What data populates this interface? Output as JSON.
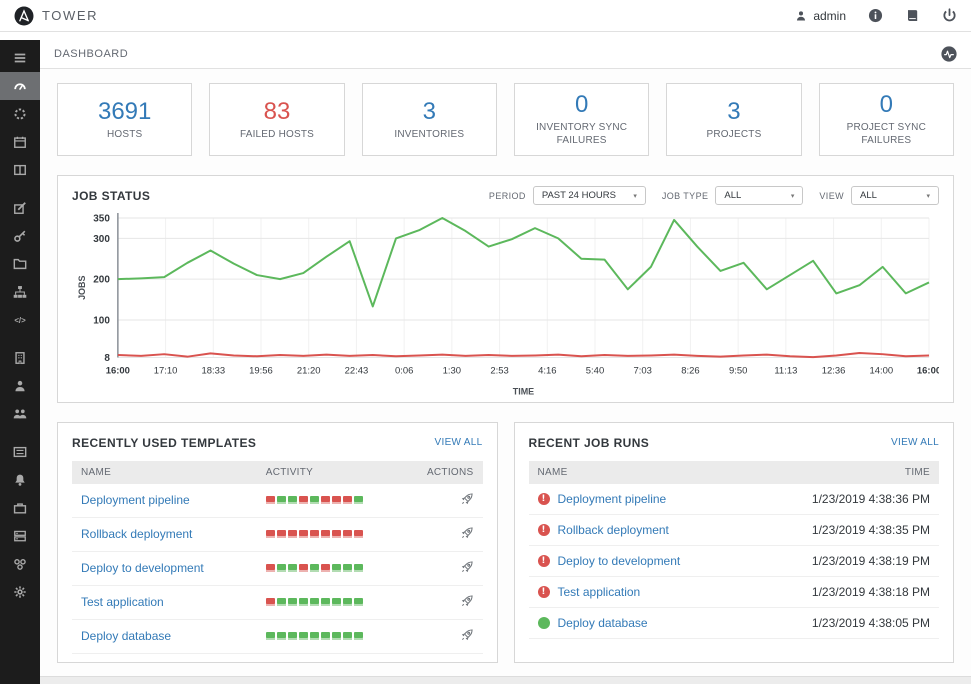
{
  "topbar": {
    "brand": "TOWER",
    "user": "admin",
    "icons": [
      "ansible-logo-icon",
      "user-icon",
      "info-icon",
      "docs-icon",
      "power-icon"
    ]
  },
  "breadcrumb": {
    "title": "DASHBOARD",
    "icons": [
      "activity-stream-icon"
    ]
  },
  "sidebar": {
    "items": [
      {
        "icon": "menu"
      },
      {
        "icon": "dashboard",
        "active": true
      },
      {
        "icon": "jobs"
      },
      {
        "icon": "schedules"
      },
      {
        "icon": "portal"
      },
      {
        "divider": true
      },
      {
        "icon": "projects"
      },
      {
        "icon": "credentials"
      },
      {
        "icon": "inventories"
      },
      {
        "icon": "templates"
      },
      {
        "icon": "inventory-scripts"
      },
      {
        "divider": true
      },
      {
        "icon": "organizations"
      },
      {
        "icon": "users"
      },
      {
        "icon": "teams"
      },
      {
        "divider": true
      },
      {
        "icon": "credential-types"
      },
      {
        "icon": "notifications"
      },
      {
        "icon": "management-jobs"
      },
      {
        "icon": "instance-groups"
      },
      {
        "icon": "applications"
      },
      {
        "icon": "settings"
      }
    ]
  },
  "stats": [
    {
      "value": "3691",
      "label": "HOSTS",
      "color": "#337ab7"
    },
    {
      "value": "83",
      "label": "FAILED HOSTS",
      "color": "#d9534f"
    },
    {
      "value": "3",
      "label": "INVENTORIES",
      "color": "#337ab7"
    },
    {
      "value": "0",
      "label": "INVENTORY SYNC FAILURES",
      "color": "#337ab7"
    },
    {
      "value": "3",
      "label": "PROJECTS",
      "color": "#337ab7"
    },
    {
      "value": "0",
      "label": "PROJECT SYNC FAILURES",
      "color": "#337ab7"
    }
  ],
  "job_status": {
    "title": "JOB STATUS",
    "filters": [
      {
        "label": "PERIOD",
        "value": "PAST 24 HOURS"
      },
      {
        "label": "JOB TYPE",
        "value": "ALL"
      },
      {
        "label": "VIEW",
        "value": "ALL"
      }
    ]
  },
  "chart_data": {
    "type": "line",
    "title": "JOB STATUS",
    "xlabel": "TIME",
    "ylabel": "JOBS",
    "ylim": [
      8,
      350
    ],
    "yticks": [
      350,
      300,
      200,
      100,
      8
    ],
    "grid": true,
    "legend": false,
    "xticklabels": [
      "16:00",
      "17:10",
      "18:33",
      "19:56",
      "21:20",
      "22:43",
      "0:06",
      "1:30",
      "2:53",
      "4:16",
      "5:40",
      "7:03",
      "8:26",
      "9:50",
      "11:13",
      "12:36",
      "14:00",
      "16:00"
    ],
    "series": [
      {
        "name": "successful",
        "color": "#5cb85c",
        "values": [
          200,
          202,
          205,
          240,
          270,
          238,
          210,
          200,
          215,
          255,
          293,
          133,
          300,
          320,
          350,
          318,
          280,
          298,
          325,
          300,
          250,
          248,
          175,
          230,
          345,
          280,
          220,
          240,
          175,
          210,
          245,
          165,
          185,
          230,
          165,
          192
        ]
      },
      {
        "name": "failed",
        "color": "#d9534f",
        "values": [
          14,
          12,
          16,
          10,
          18,
          13,
          11,
          14,
          12,
          15,
          12,
          14,
          11,
          13,
          15,
          12,
          14,
          12,
          13,
          15,
          11,
          14,
          12,
          13,
          15,
          12,
          10,
          13,
          15,
          11,
          9,
          13,
          19,
          16,
          11,
          13
        ]
      }
    ]
  },
  "templates_panel": {
    "title": "RECENTLY USED TEMPLATES",
    "view_all": "VIEW ALL",
    "columns": [
      "NAME",
      "ACTIVITY",
      "ACTIONS"
    ],
    "rows": [
      {
        "name": "Deployment pipeline",
        "activity": [
          "f",
          "s",
          "s",
          "f",
          "s",
          "f",
          "f",
          "f",
          "s"
        ]
      },
      {
        "name": "Rollback deployment",
        "activity": [
          "f",
          "f",
          "f",
          "f",
          "f",
          "f",
          "f",
          "f",
          "f"
        ]
      },
      {
        "name": "Deploy to development",
        "activity": [
          "f",
          "s",
          "s",
          "f",
          "s",
          "f",
          "s",
          "s",
          "s"
        ]
      },
      {
        "name": "Test application",
        "activity": [
          "f",
          "s",
          "s",
          "s",
          "s",
          "s",
          "s",
          "s",
          "s"
        ]
      },
      {
        "name": "Deploy database",
        "activity": [
          "s",
          "s",
          "s",
          "s",
          "s",
          "s",
          "s",
          "s",
          "s"
        ]
      }
    ]
  },
  "jobs_panel": {
    "title": "RECENT JOB RUNS",
    "view_all": "VIEW ALL",
    "columns": [
      "NAME",
      "TIME"
    ],
    "rows": [
      {
        "status": "failed",
        "name": "Deployment pipeline",
        "time": "1/23/2019 4:38:36 PM"
      },
      {
        "status": "failed",
        "name": "Rollback deployment",
        "time": "1/23/2019 4:38:35 PM"
      },
      {
        "status": "failed",
        "name": "Deploy to development",
        "time": "1/23/2019 4:38:19 PM"
      },
      {
        "status": "failed",
        "name": "Test application",
        "time": "1/23/2019 4:38:18 PM"
      },
      {
        "status": "success",
        "name": "Deploy database",
        "time": "1/23/2019 4:38:05 PM"
      }
    ]
  },
  "colors": {
    "accent": "#337ab7",
    "success": "#5cb85c",
    "failure": "#d9534f",
    "sidebar_bg": "#1c1c1c"
  }
}
